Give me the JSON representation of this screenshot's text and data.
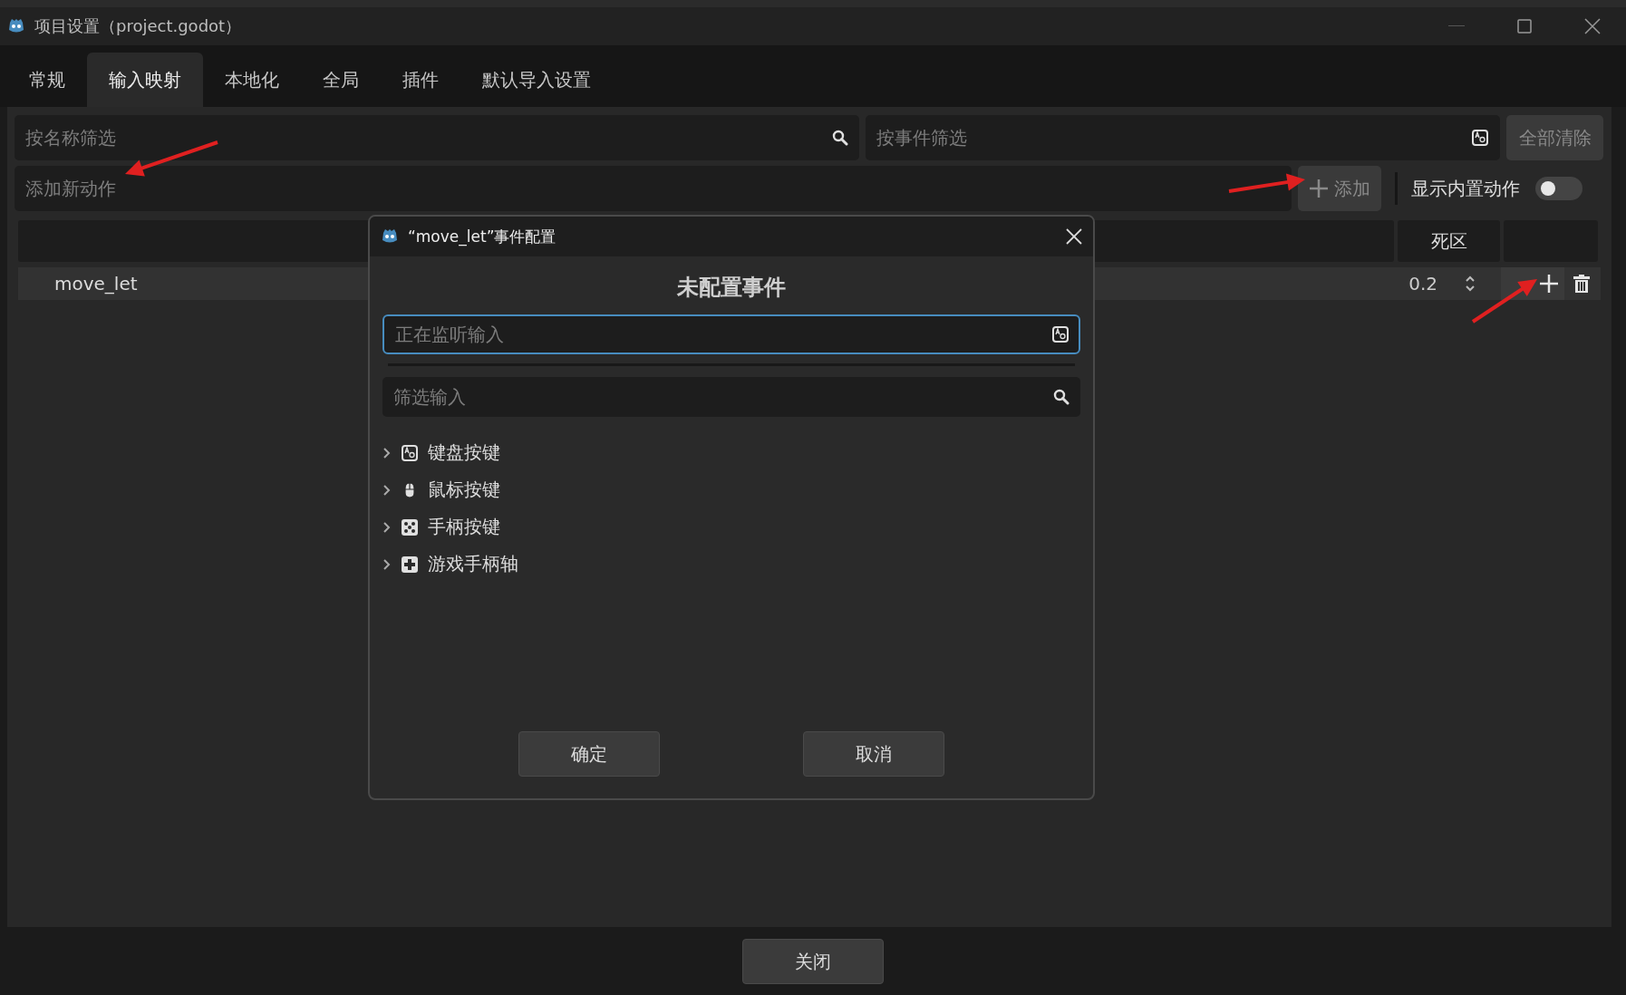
{
  "window": {
    "title": "项目设置（project.godot）"
  },
  "tabs": [
    {
      "label": "常规",
      "selected": false
    },
    {
      "label": "输入映射",
      "selected": true
    },
    {
      "label": "本地化",
      "selected": false
    },
    {
      "label": "全局",
      "selected": false
    },
    {
      "label": "插件",
      "selected": false
    },
    {
      "label": "默认导入设置",
      "selected": false
    }
  ],
  "filters": {
    "name_placeholder": "按名称筛选",
    "event_placeholder": "按事件筛选",
    "clear_all": "全部清除"
  },
  "add_action": {
    "placeholder": "添加新动作",
    "add_button": "添加",
    "show_builtin": {
      "label": "显示内置动作",
      "on": false
    }
  },
  "table": {
    "deadzone_header": "死区",
    "rows": [
      {
        "name": "move_let",
        "deadzone": "0.2"
      }
    ]
  },
  "dialog": {
    "title": "“move_let”事件配置",
    "heading": "未配置事件",
    "listen_placeholder": "正在监听输入",
    "filter_placeholder": "筛选输入",
    "categories": [
      {
        "label": "键盘按键",
        "kind": "keyboard",
        "expanded": false
      },
      {
        "label": "鼠标按键",
        "kind": "mouse",
        "expanded": false
      },
      {
        "label": "手柄按键",
        "kind": "joypad_button",
        "expanded": false
      },
      {
        "label": "游戏手柄轴",
        "kind": "joypad_axis",
        "expanded": false
      }
    ],
    "buttons": [
      "确定",
      "取消"
    ]
  },
  "footer": {
    "close": "关闭"
  }
}
